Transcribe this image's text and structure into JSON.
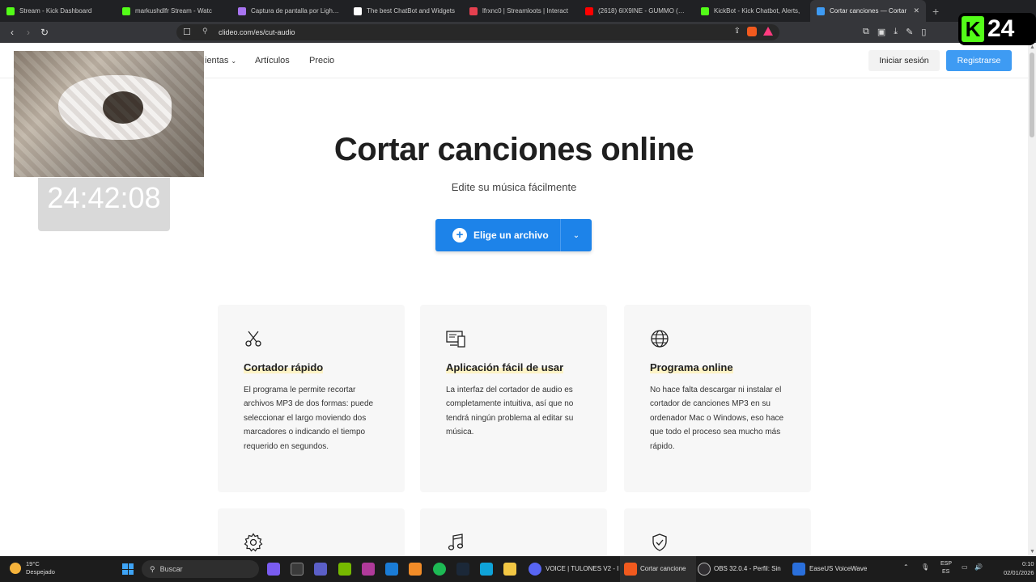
{
  "browser": {
    "tabs": [
      {
        "label": "Stream - Kick Dashboard",
        "icon": "kick-icon",
        "color": "#53fc18"
      },
      {
        "label": "markushdlfr Stream - Watc",
        "icon": "kick-icon",
        "color": "#53fc18"
      },
      {
        "label": "Captura de pantalla por Lightsh",
        "icon": "feather-icon",
        "color": "#a874f0"
      },
      {
        "label": "The best ChatBot and Widgets",
        "icon": "diamond-icon",
        "color": "#ffffff"
      },
      {
        "label": "lfrxnc0 | Streamloots | Interact",
        "icon": "streamloots-icon",
        "color": "#e5404f"
      },
      {
        "label": "(2618) 6IX9INE - GUMMO (OFF",
        "icon": "youtube-icon",
        "color": "#ff0000"
      },
      {
        "label": "KickBot - Kick Chatbot, Alerts,",
        "icon": "kickbot-icon",
        "color": "#53fc18"
      },
      {
        "label": "Cortar canciones — Cortar",
        "icon": "clideo-icon",
        "color": "#3e9bf3",
        "active": true
      }
    ],
    "url": "clideo.com/es/cut-audio"
  },
  "site": {
    "nav": {
      "tools": "ientas",
      "articles": "Artículos",
      "price": "Precio"
    },
    "login": "Iniciar sesión",
    "register": "Registrarse"
  },
  "hero": {
    "title": "Cortar canciones online",
    "subtitle": "Edite su música fácilmente",
    "button": "Elige un archivo"
  },
  "cards": [
    {
      "icon": "scissors-icon",
      "title": "Cortador rápido",
      "text": "El programa le permite recortar archivos MP3 de dos formas: puede seleccionar el largo moviendo dos marcadores o indicando el tiempo requerido en segundos."
    },
    {
      "icon": "devices-icon",
      "title": "Aplicación fácil de usar",
      "text": "La interfaz del cortador de audio es completamente intuitiva, así que no tendrá ningún problema al editar su música."
    },
    {
      "icon": "globe-icon",
      "title": "Programa online",
      "text": "No hace falta descargar ni instalar el cortador de canciones MP3 en su ordenador Mac o Windows, eso hace que todo el proceso sea mucho más rápido."
    }
  ],
  "cards_row2": [
    {
      "icon": "gear-icon"
    },
    {
      "icon": "music-note-icon"
    },
    {
      "icon": "shield-check-icon"
    }
  ],
  "overlay": {
    "timer": "24:42:08",
    "kick_count": "24"
  },
  "taskbar": {
    "temp": "19°C",
    "weather": "Despejado",
    "search": "Buscar",
    "app_voice": "VOICE | TULONES V2 - I",
    "app_browser": "Cortar cancione",
    "app_obs": "OBS 32.0.4 - Perfil: Sin",
    "app_easeus": "EaseUS VoiceWave",
    "lang1": "ESP",
    "lang2": "ES",
    "time": "0:10",
    "date": "02/01/2026"
  }
}
